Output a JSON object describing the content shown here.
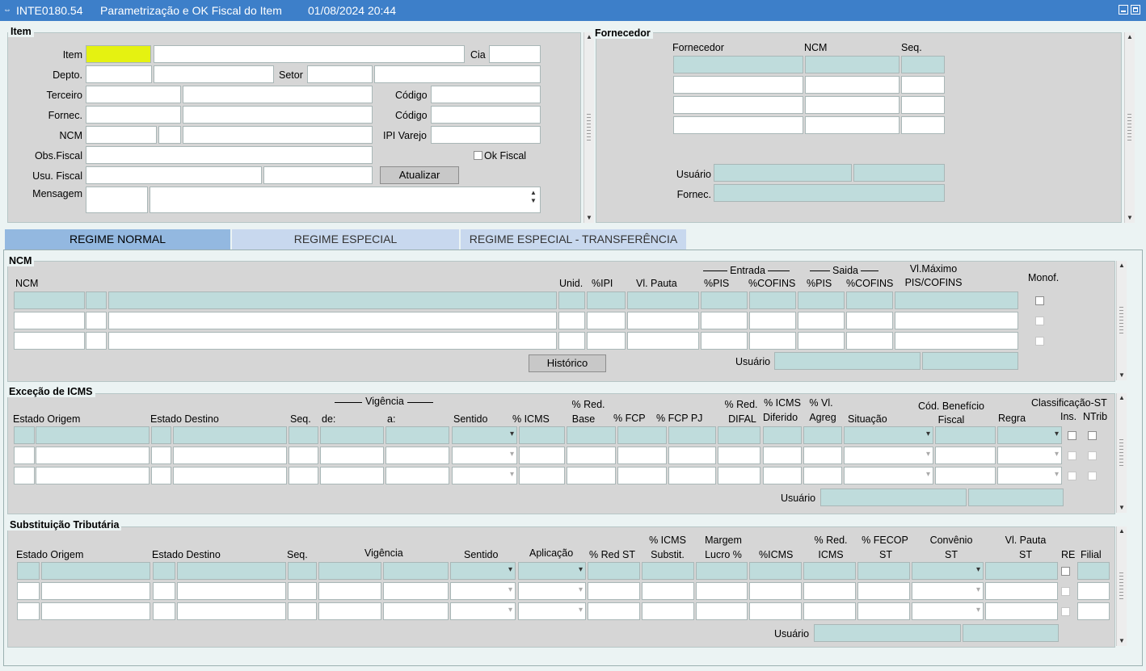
{
  "window": {
    "code": "INTE0180.54",
    "title": "Parametrização e OK Fiscal do Item",
    "datetime": "01/08/2024 20:44"
  },
  "item": {
    "legend": "Item",
    "labels": {
      "item": "Item",
      "cia": "Cia",
      "depto": "Depto.",
      "setor": "Setor",
      "terceiro": "Terceiro",
      "codigo": "Código",
      "fornec": "Fornec.",
      "codigo2": "Código",
      "ncm": "NCM",
      "ipi_varejo": "IPI Varejo",
      "obs_fiscal": "Obs.Fiscal",
      "ok_fiscal": "Ok Fiscal",
      "usu_fiscal": "Usu. Fiscal",
      "mensagem": "Mensagem"
    },
    "atualizar": "Atualizar"
  },
  "fornecedor": {
    "legend": "Fornecedor",
    "cols": {
      "fornecedor": "Fornecedor",
      "ncm": "NCM",
      "seq": "Seq."
    },
    "labels": {
      "usuario": "Usuário",
      "fornec": "Fornec."
    }
  },
  "tabs": [
    "REGIME NORMAL",
    "REGIME ESPECIAL",
    "REGIME ESPECIAL - TRANSFERÊNCIA"
  ],
  "ncm": {
    "legend": "NCM",
    "cols": {
      "ncm": "NCM",
      "unid": "Unid.",
      "ipi": "%IPI",
      "vl_pauta": "Vl. Pauta",
      "entrada": "Entrada",
      "saida": "Saida",
      "pis": "%PIS",
      "cofins": "%COFINS",
      "pis2": "%PIS",
      "cofins2": "%COFINS",
      "vlmax1": "Vl.Máximo",
      "vlmax2": "PIS/COFINS",
      "monof": "Monof."
    },
    "historico": "Histórico",
    "usuario": "Usuário"
  },
  "icms": {
    "legend": "Exceção de ICMS",
    "cols": {
      "estado_origem": "Estado Origem",
      "estado_destino": "Estado Destino",
      "seq": "Seq.",
      "vigencia": "Vigência",
      "de": "de:",
      "a": "a:",
      "sentido": "Sentido",
      "icms": "% ICMS",
      "red_base1": "% Red.",
      "red_base2": "Base",
      "fcp": "% FCP",
      "fcp_pj": "% FCP PJ",
      "red_difal1": "% Red.",
      "red_difal2": "DIFAL",
      "icms_dif1": "% ICMS",
      "icms_dif2": "Diferido",
      "vl_agreg1": "% Vl.",
      "vl_agreg2": "Agreg",
      "situacao": "Situação",
      "cod_benef1": "Cód. Benefício",
      "cod_benef2": "Fiscal",
      "regra": "Regra",
      "class_st": "Classificação-ST",
      "ins": "Ins.",
      "ntrib": "NTrib"
    },
    "usuario": "Usuário"
  },
  "st": {
    "legend": "Substituição Tributária",
    "cols": {
      "estado_origem": "Estado Origem",
      "estado_destino": "Estado Destino",
      "seq": "Seq.",
      "vigencia": "Vigência",
      "sentido": "Sentido",
      "aplicacao": "Aplicação",
      "red_st": "% Red ST",
      "icms_subst1": "% ICMS",
      "icms_subst2": "Substit.",
      "margem1": "Margem",
      "margem2": "Lucro %",
      "icms": "%ICMS",
      "red_icms1": "% Red.",
      "red_icms2": "ICMS",
      "fecop1": "% FECOP",
      "fecop2": "ST",
      "conv1": "Convênio",
      "conv2": "ST",
      "vl_pauta1": "Vl. Pauta",
      "vl_pauta2": "ST",
      "re": "RE",
      "filial": "Filial"
    },
    "usuario": "Usuário"
  }
}
